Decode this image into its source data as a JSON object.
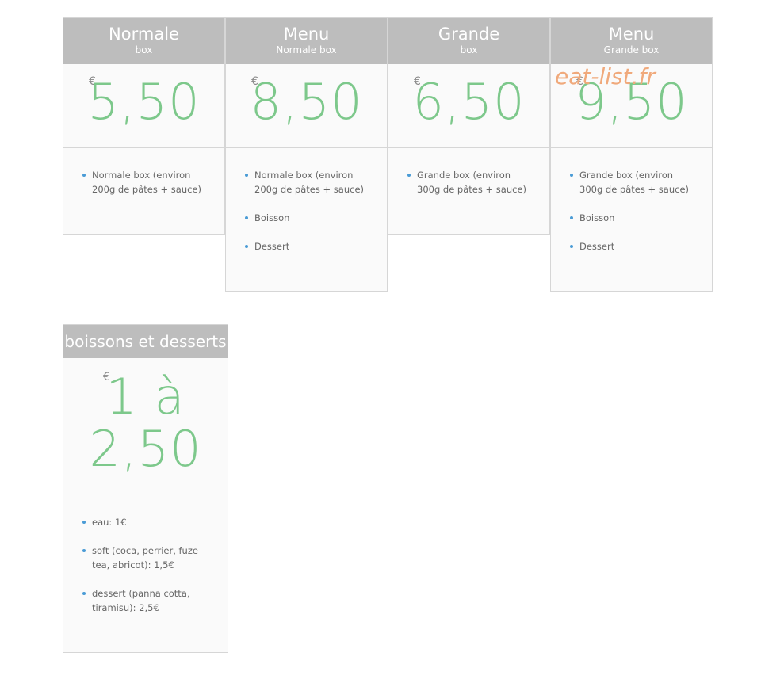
{
  "plans": [
    {
      "title": "Normale",
      "subtitle": "box",
      "currency": "€",
      "price": "5,50",
      "features": [
        "Normale box (environ 200g de pâtes + sauce)"
      ]
    },
    {
      "title": "Menu",
      "subtitle": "Normale box",
      "currency": "€",
      "price": "8,50",
      "features": [
        "Normale box (environ 200g de pâtes + sauce)",
        "Boisson",
        "Dessert"
      ]
    },
    {
      "title": "Grande",
      "subtitle": "box",
      "currency": "€",
      "price": "6,50",
      "features": [
        "Grande box (environ 300g de pâtes + sauce)"
      ]
    },
    {
      "title": "Menu",
      "subtitle": "Grande box",
      "currency": "€",
      "price": "9,50",
      "features": [
        "Grande box (environ 300g de pâtes + sauce)",
        "Boisson",
        "Dessert"
      ]
    }
  ],
  "drinks": {
    "title": "boissons et desserts",
    "currency": "€",
    "price_line1": "1 à",
    "price_line2": "2,50",
    "features": [
      "eau: 1€",
      "soft (coca, perrier, fuze tea, abricot): 1,5€",
      "dessert (panna cotta, tiramisu): 2,5€"
    ]
  },
  "watermark": "eat-list.fr",
  "colors": {
    "header_bg": "#bdbdbd",
    "price": "#7dc88b",
    "bullet": "#4a9bd6",
    "watermark": "#f0a97b"
  }
}
